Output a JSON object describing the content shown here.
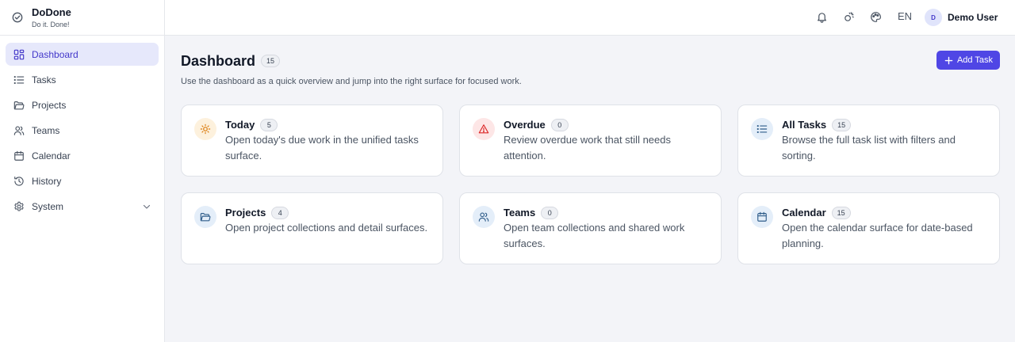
{
  "app": {
    "name": "DoDone",
    "tagline": "Do it. Done!"
  },
  "sidebar": {
    "items": [
      {
        "label": "Dashboard",
        "icon": "dashboard-icon",
        "active": true
      },
      {
        "label": "Tasks",
        "icon": "list-icon"
      },
      {
        "label": "Projects",
        "icon": "folder-icon"
      },
      {
        "label": "Teams",
        "icon": "users-icon"
      },
      {
        "label": "Calendar",
        "icon": "calendar-icon"
      },
      {
        "label": "History",
        "icon": "history-icon"
      },
      {
        "label": "System",
        "icon": "gear-icon",
        "expandable": true
      }
    ]
  },
  "topbar": {
    "icons": [
      "bell-icon",
      "theme-toggle-icon",
      "palette-icon"
    ],
    "language": "EN",
    "user": {
      "initial": "D",
      "name": "Demo User"
    }
  },
  "page": {
    "title": "Dashboard",
    "count": "15",
    "subtitle": "Use the dashboard as a quick overview and jump into the right surface for focused work.",
    "add_button": "Add Task"
  },
  "cards": [
    {
      "title": "Today",
      "count": "5",
      "desc": "Open today's due work in the unified tasks surface.",
      "icon": "sun-icon",
      "accent": "#d97706"
    },
    {
      "title": "Overdue",
      "count": "0",
      "desc": "Review overdue work that still needs attention.",
      "icon": "warning-icon",
      "accent": "#dc2626"
    },
    {
      "title": "All Tasks",
      "count": "15",
      "desc": "Browse the full task list with filters and sorting.",
      "icon": "list-icon",
      "accent": "#2f5d8a"
    },
    {
      "title": "Projects",
      "count": "4",
      "desc": "Open project collections and detail surfaces.",
      "icon": "folder-icon",
      "accent": "#2f5d8a"
    },
    {
      "title": "Teams",
      "count": "0",
      "desc": "Open team collections and shared work surfaces.",
      "icon": "users-icon",
      "accent": "#2f5d8a"
    },
    {
      "title": "Calendar",
      "count": "15",
      "desc": "Open the calendar surface for date-based planning.",
      "icon": "calendar-icon",
      "accent": "#2f5d8a"
    }
  ],
  "colors": {
    "accent": "#4f46e5",
    "active_nav_bg": "#e6e8fb",
    "background": "#f3f4f8"
  }
}
